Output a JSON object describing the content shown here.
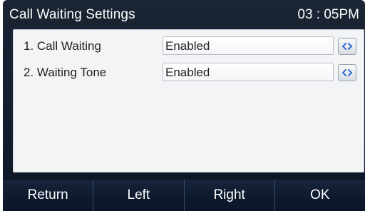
{
  "header": {
    "title": "Call Waiting Settings",
    "time": "03 : 05PM"
  },
  "settings": [
    {
      "label": "1. Call Waiting",
      "value": "Enabled",
      "switch_icon": "left-right-arrows-icon"
    },
    {
      "label": "2. Waiting Tone",
      "value": "Enabled",
      "switch_icon": "left-right-arrows-icon"
    }
  ],
  "softkeys": {
    "return": "Return",
    "left": "Left",
    "right": "Right",
    "ok": "OK"
  },
  "colors": {
    "accent": "#1b5fcf",
    "background": "#152030",
    "panel": "#f3f4f6"
  }
}
